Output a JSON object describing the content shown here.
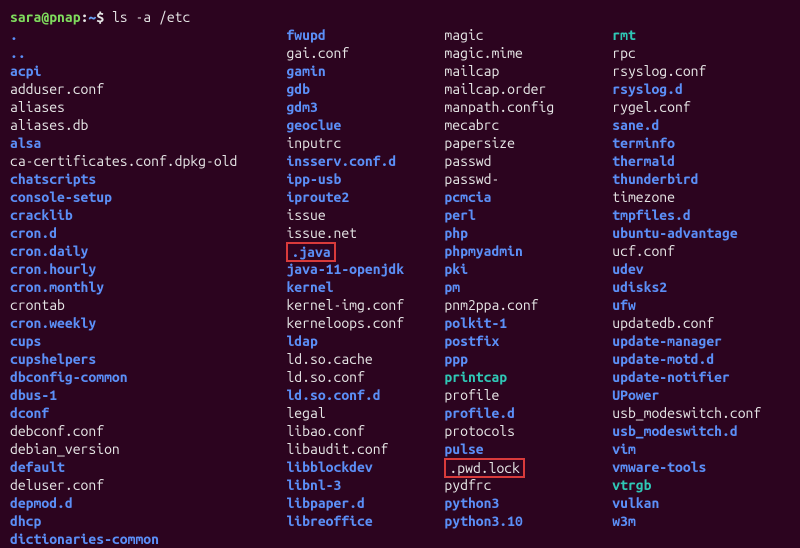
{
  "prompt": {
    "user": "sara@pnap",
    "path": "~",
    "symbol": "$",
    "command": "ls -a /etc"
  },
  "columns": [
    [
      {
        "t": ".",
        "c": "blue"
      },
      {
        "t": "..",
        "c": "blue"
      },
      {
        "t": "acpi",
        "c": "blue"
      },
      {
        "t": "adduser.conf",
        "c": "white"
      },
      {
        "t": "aliases",
        "c": "white"
      },
      {
        "t": "aliases.db",
        "c": "white"
      },
      {
        "t": "alsa",
        "c": "blue"
      },
      {
        "t": "ca-certificates.conf.dpkg-old",
        "c": "white"
      },
      {
        "t": "chatscripts",
        "c": "blue"
      },
      {
        "t": "console-setup",
        "c": "blue"
      },
      {
        "t": "cracklib",
        "c": "blue"
      },
      {
        "t": "cron.d",
        "c": "blue"
      },
      {
        "t": "cron.daily",
        "c": "blue"
      },
      {
        "t": "cron.hourly",
        "c": "blue"
      },
      {
        "t": "cron.monthly",
        "c": "blue"
      },
      {
        "t": "crontab",
        "c": "white"
      },
      {
        "t": "cron.weekly",
        "c": "blue"
      },
      {
        "t": "cups",
        "c": "blue"
      },
      {
        "t": "cupshelpers",
        "c": "blue"
      },
      {
        "t": "dbconfig-common",
        "c": "blue"
      },
      {
        "t": "dbus-1",
        "c": "blue"
      },
      {
        "t": "dconf",
        "c": "blue"
      },
      {
        "t": "debconf.conf",
        "c": "white"
      },
      {
        "t": "debian_version",
        "c": "white"
      },
      {
        "t": "default",
        "c": "blue"
      },
      {
        "t": "deluser.conf",
        "c": "white"
      },
      {
        "t": "depmod.d",
        "c": "blue"
      },
      {
        "t": "dhcp",
        "c": "blue"
      },
      {
        "t": "dictionaries-common",
        "c": "blue"
      }
    ],
    [
      {
        "t": "fwupd",
        "c": "blue"
      },
      {
        "t": "gai.conf",
        "c": "white"
      },
      {
        "t": "gamin",
        "c": "blue"
      },
      {
        "t": "gdb",
        "c": "blue"
      },
      {
        "t": "gdm3",
        "c": "blue"
      },
      {
        "t": "geoclue",
        "c": "blue"
      },
      {
        "t": "inputrc",
        "c": "white"
      },
      {
        "t": "insserv.conf.d",
        "c": "blue"
      },
      {
        "t": "ipp-usb",
        "c": "blue"
      },
      {
        "t": "iproute2",
        "c": "blue"
      },
      {
        "t": "issue",
        "c": "white"
      },
      {
        "t": "issue.net",
        "c": "white"
      },
      {
        "t": ".java",
        "c": "blue",
        "hl": true
      },
      {
        "t": "java-11-openjdk",
        "c": "blue"
      },
      {
        "t": "kernel",
        "c": "blue"
      },
      {
        "t": "kernel-img.conf",
        "c": "white"
      },
      {
        "t": "kerneloops.conf",
        "c": "white"
      },
      {
        "t": "ldap",
        "c": "blue"
      },
      {
        "t": "ld.so.cache",
        "c": "white"
      },
      {
        "t": "ld.so.conf",
        "c": "white"
      },
      {
        "t": "ld.so.conf.d",
        "c": "blue"
      },
      {
        "t": "legal",
        "c": "white"
      },
      {
        "t": "libao.conf",
        "c": "white"
      },
      {
        "t": "libaudit.conf",
        "c": "white"
      },
      {
        "t": "libblockdev",
        "c": "blue"
      },
      {
        "t": "libnl-3",
        "c": "blue"
      },
      {
        "t": "libpaper.d",
        "c": "blue"
      },
      {
        "t": "libreoffice",
        "c": "blue"
      }
    ],
    [
      {
        "t": "magic",
        "c": "white"
      },
      {
        "t": "magic.mime",
        "c": "white"
      },
      {
        "t": "mailcap",
        "c": "white"
      },
      {
        "t": "mailcap.order",
        "c": "white"
      },
      {
        "t": "manpath.config",
        "c": "white"
      },
      {
        "t": "mecabrc",
        "c": "white"
      },
      {
        "t": "papersize",
        "c": "white"
      },
      {
        "t": "passwd",
        "c": "white"
      },
      {
        "t": "passwd-",
        "c": "white"
      },
      {
        "t": "pcmcia",
        "c": "blue"
      },
      {
        "t": "perl",
        "c": "blue"
      },
      {
        "t": "php",
        "c": "blue"
      },
      {
        "t": "phpmyadmin",
        "c": "blue"
      },
      {
        "t": "pki",
        "c": "blue"
      },
      {
        "t": "pm",
        "c": "blue"
      },
      {
        "t": "pnm2ppa.conf",
        "c": "white"
      },
      {
        "t": "polkit-1",
        "c": "blue"
      },
      {
        "t": "postfix",
        "c": "blue"
      },
      {
        "t": "ppp",
        "c": "blue"
      },
      {
        "t": "printcap",
        "c": "cyan"
      },
      {
        "t": "profile",
        "c": "white"
      },
      {
        "t": "profile.d",
        "c": "blue"
      },
      {
        "t": "protocols",
        "c": "white"
      },
      {
        "t": "pulse",
        "c": "blue"
      },
      {
        "t": ".pwd.lock",
        "c": "white",
        "hl": true
      },
      {
        "t": "pydfrc",
        "c": "white"
      },
      {
        "t": "python3",
        "c": "blue"
      },
      {
        "t": "python3.10",
        "c": "blue"
      }
    ],
    [
      {
        "t": "rmt",
        "c": "cyan"
      },
      {
        "t": "rpc",
        "c": "white"
      },
      {
        "t": "rsyslog.conf",
        "c": "white"
      },
      {
        "t": "rsyslog.d",
        "c": "blue"
      },
      {
        "t": "rygel.conf",
        "c": "white"
      },
      {
        "t": "sane.d",
        "c": "blue"
      },
      {
        "t": "terminfo",
        "c": "blue"
      },
      {
        "t": "thermald",
        "c": "blue"
      },
      {
        "t": "thunderbird",
        "c": "blue"
      },
      {
        "t": "timezone",
        "c": "white"
      },
      {
        "t": "tmpfiles.d",
        "c": "blue"
      },
      {
        "t": "ubuntu-advantage",
        "c": "blue"
      },
      {
        "t": "ucf.conf",
        "c": "white"
      },
      {
        "t": "udev",
        "c": "blue"
      },
      {
        "t": "udisks2",
        "c": "blue"
      },
      {
        "t": "ufw",
        "c": "blue"
      },
      {
        "t": "updatedb.conf",
        "c": "white"
      },
      {
        "t": "update-manager",
        "c": "blue"
      },
      {
        "t": "update-motd.d",
        "c": "blue"
      },
      {
        "t": "update-notifier",
        "c": "blue"
      },
      {
        "t": "UPower",
        "c": "blue"
      },
      {
        "t": "usb_modeswitch.conf",
        "c": "white"
      },
      {
        "t": "usb_modeswitch.d",
        "c": "blue"
      },
      {
        "t": "vim",
        "c": "blue"
      },
      {
        "t": "vmware-tools",
        "c": "blue"
      },
      {
        "t": "vtrgb",
        "c": "cyan"
      },
      {
        "t": "vulkan",
        "c": "blue"
      },
      {
        "t": "w3m",
        "c": "blue"
      }
    ]
  ]
}
